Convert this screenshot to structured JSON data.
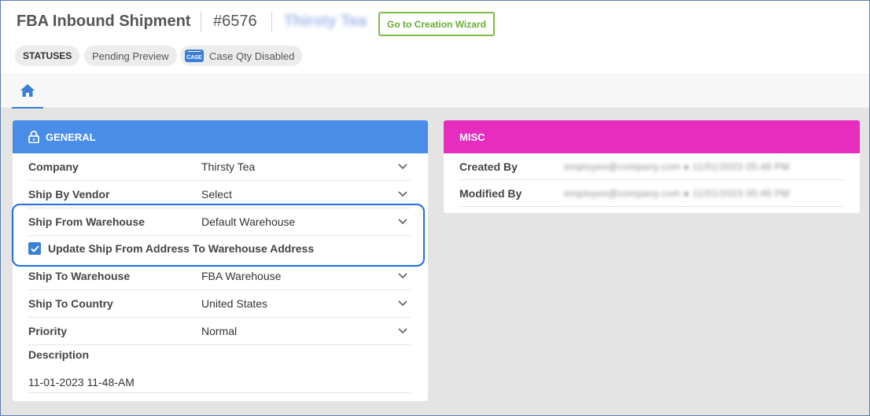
{
  "header": {
    "title": "FBA Inbound Shipment",
    "order_number": "#6576",
    "company_name_blurred": "Thirsty Tea",
    "wizard_button": "Go to Creation Wizard"
  },
  "statuses": {
    "label": "STATUSES",
    "chips": [
      "Pending Preview",
      "Case Qty Disabled"
    ],
    "case_icon_text": "CASE"
  },
  "tabs": {
    "home_icon": "home-icon"
  },
  "general": {
    "title": "GENERAL",
    "fields": [
      {
        "label": "Company",
        "value": "Thirsty Tea"
      },
      {
        "label": "Ship By Vendor",
        "value": "Select"
      },
      {
        "label": "Ship From Warehouse",
        "value": "Default Warehouse"
      },
      {
        "label": "Ship To Warehouse",
        "value": "FBA Warehouse"
      },
      {
        "label": "Ship To Country",
        "value": "United States"
      },
      {
        "label": "Priority",
        "value": "Normal"
      }
    ],
    "checkbox_label": "Update Ship From Address To Warehouse Address",
    "checkbox_checked": true,
    "description_label": "Description",
    "description_value": "11-01-2023 11-48-AM"
  },
  "misc": {
    "title": "MISC",
    "created_by_label": "Created By",
    "created_by_value": "employee@company.com ● 11/01/2023 05:48 PM",
    "modified_by_label": "Modified By",
    "modified_by_value": "employee@company.com ● 11/01/2023 05:48 PM"
  },
  "colors": {
    "general_header": "#4a8de8",
    "misc_header": "#e62dbe",
    "wizard_border": "#7dbb45",
    "accent": "#3a7fd8"
  }
}
